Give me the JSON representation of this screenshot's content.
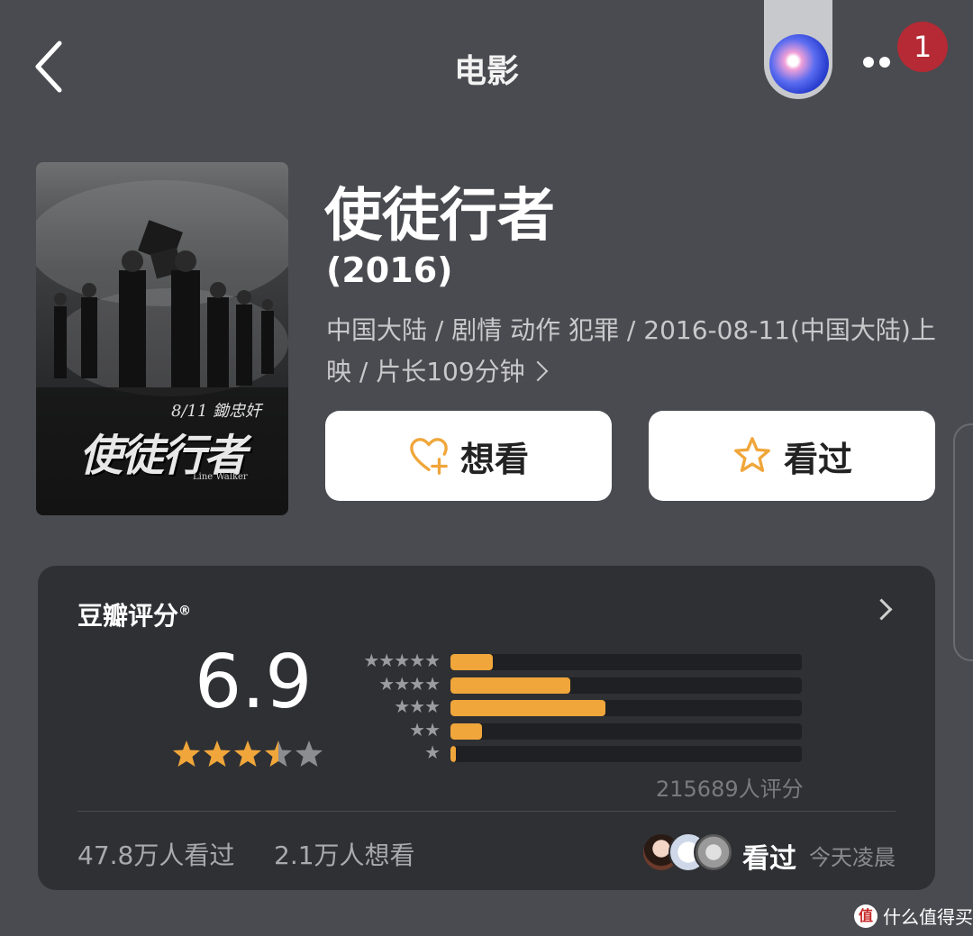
{
  "topbar": {
    "title": "电影",
    "notification_count": "1"
  },
  "movie": {
    "poster_title": "使徒行者",
    "poster_date": "8/11 鋤忠奸",
    "poster_en": "Line Walker",
    "title": "使徒行者",
    "year": "(2016)",
    "meta": "中国大陆 / 剧情 动作 犯罪 / 2016-08-11(中国大陆)上映 / 片长109分钟"
  },
  "actions": {
    "want_label": "想看",
    "seen_label": "看过"
  },
  "rating": {
    "label": "豆瓣评分",
    "mark": "®",
    "score": "6.9",
    "star_rating": 3.5,
    "distribution": [
      {
        "stars": "★★★★★",
        "percent": 12
      },
      {
        "stars": "★★★★",
        "percent": 34
      },
      {
        "stars": "★★★",
        "percent": 44
      },
      {
        "stars": "★★",
        "percent": 9
      },
      {
        "stars": "★",
        "percent": 1.5
      }
    ],
    "votes": "215689人评分",
    "seen_count": "47.8万人看过",
    "want_count": "2.1万人想看",
    "friend_status": "看过",
    "friend_time": "今天凌晨"
  },
  "colors": {
    "accent": "#f0a63a",
    "background": "#4a4b50",
    "card": "#2f3034",
    "badge": "#b52a34"
  },
  "watermark": {
    "logo": "值",
    "text": "什么值得买"
  }
}
